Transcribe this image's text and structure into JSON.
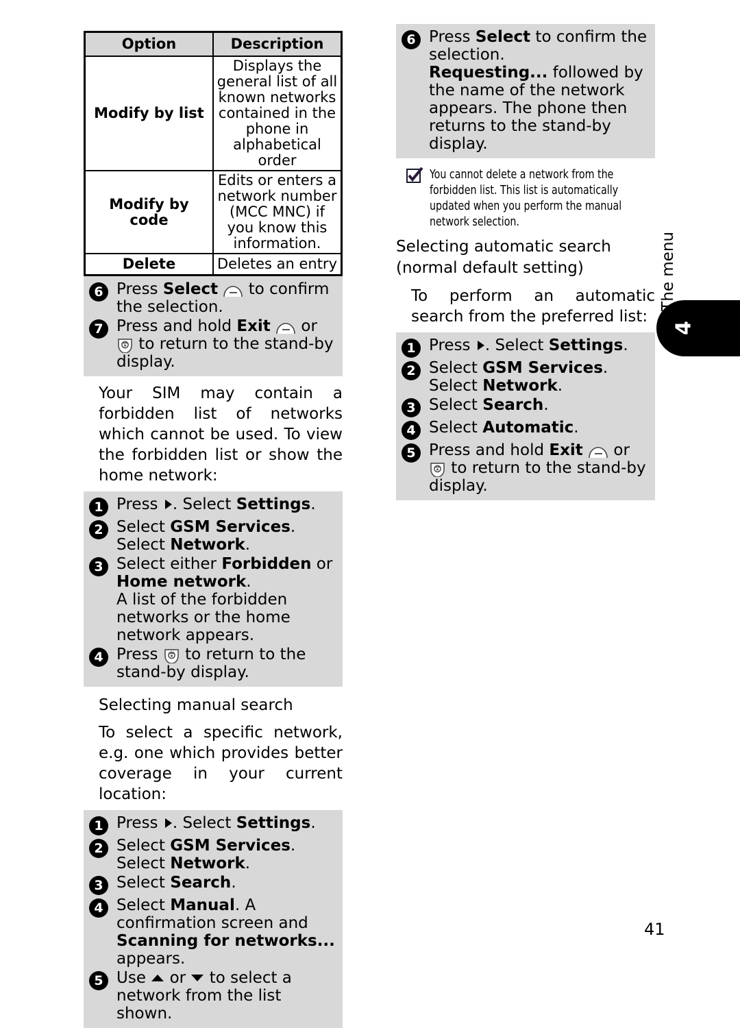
{
  "page": {
    "number": "41",
    "edge_tab_label": "The menu",
    "edge_tab_number": "4",
    "colors": {
      "step_block_bg": "#d8d8d8",
      "table_header_bg": "#d6d6d6",
      "tab_bg": "#000000",
      "text": "#000000"
    }
  },
  "table": {
    "headers": [
      "Option",
      "Description"
    ],
    "rows": [
      {
        "option": "Modify by list",
        "description": "Displays the general list of all known networks contained in the phone in alphabetical order"
      },
      {
        "option": "Modify by code",
        "description": "Edits or enters a network number (MCC MNC) if you know this information."
      },
      {
        "option": "Delete",
        "description": "Deletes an entry"
      }
    ]
  },
  "left_column": {
    "steps_after_table": {
      "step6": {
        "num": "6",
        "parts": [
          "Press ",
          "Select",
          " ",
          "softkey-icon",
          " to confirm the selection."
        ]
      },
      "step7": {
        "num": "7",
        "parts": [
          "Press and hold ",
          "Exit",
          " ",
          "softkey-icon",
          " or ",
          "endcall-icon",
          " to return to the stand-by display."
        ]
      }
    },
    "forbidden_intro": "Your SIM may contain a forbidden list of networks which cannot be used. To view the forbidden list or show the home network:",
    "forbidden_steps": [
      {
        "num": "1",
        "text_before": "Press ",
        "icon": "right-arrow-icon",
        "text_after": ". Select ",
        "bold": "Settings",
        "tail": "."
      },
      {
        "num": "2",
        "text_before": "Select ",
        "bold": "GSM Services",
        "mid": ". Select ",
        "bold2": "Network",
        "tail": "."
      },
      {
        "num": "3",
        "text_before": "Select either ",
        "bold": "Forbidden",
        "mid": " or ",
        "bold2": "Home network",
        "tail": ".",
        "sub": "A list of the forbidden networks or the home network appears."
      },
      {
        "num": "4",
        "text_before": "Press ",
        "icon": "endcall-icon",
        "text_after": " to return to the stand-by display."
      }
    ],
    "manual_heading": "Selecting manual search",
    "manual_intro": "To select a specific network, e.g. one which provides better coverage in your current location:",
    "manual_steps": [
      {
        "num": "1",
        "text_before": "Press ",
        "icon": "right-arrow-icon",
        "text_after": ". Select ",
        "bold": "Settings",
        "tail": "."
      },
      {
        "num": "2",
        "text_before": "Select ",
        "bold": "GSM Services",
        "mid": ". Select ",
        "bold2": "Network",
        "tail": "."
      },
      {
        "num": "3",
        "text_before": "Select ",
        "bold": "Search",
        "tail": "."
      },
      {
        "num": "4",
        "text_before": "Select ",
        "bold": "Manual",
        "mid": ". A confirmation screen and ",
        "bold2": "Scanning for networks...",
        "tail": " appears."
      },
      {
        "num": "5",
        "text_before": "Use ",
        "icon": "up-arrow-icon",
        "mid_icon": " or ",
        "icon2": "down-arrow-icon",
        "text_after": " to select a network from the list shown."
      }
    ]
  },
  "right_column": {
    "step6": {
      "num": "6",
      "line1_before": "Press ",
      "line1_bold": "Select",
      "line1_after": " to confirm the selection.",
      "line2_bold": "Requesting...",
      "line2_after": " followed by the name of the network appears. The phone then returns to the stand-by display."
    },
    "note": {
      "icon": "checkbox-checked-icon",
      "text": "You cannot delete a network from the forbidden list. This list is automatically updated when you perform the manual network selection."
    },
    "auto_heading": "Selecting automatic search (normal default setting)",
    "auto_intro": "To perform an automatic search from the preferred list:",
    "auto_steps": [
      {
        "num": "1",
        "text_before": "Press ",
        "icon": "right-arrow-icon",
        "text_after": ". Select ",
        "bold": "Settings",
        "tail": "."
      },
      {
        "num": "2",
        "text_before": "Select ",
        "bold": "GSM Services",
        "mid": ". Select ",
        "bold2": "Network",
        "tail": "."
      },
      {
        "num": "3",
        "text_before": "Select ",
        "bold": "Search",
        "tail": "."
      },
      {
        "num": "4",
        "text_before": "Select ",
        "bold": "Automatic",
        "tail": "."
      },
      {
        "num": "5",
        "text_before": "Press and hold ",
        "bold": "Exit",
        "icon": "softkey-icon",
        "mid": " or ",
        "icon2": "endcall-icon",
        "text_after": " to return to the stand-by display."
      }
    ]
  }
}
